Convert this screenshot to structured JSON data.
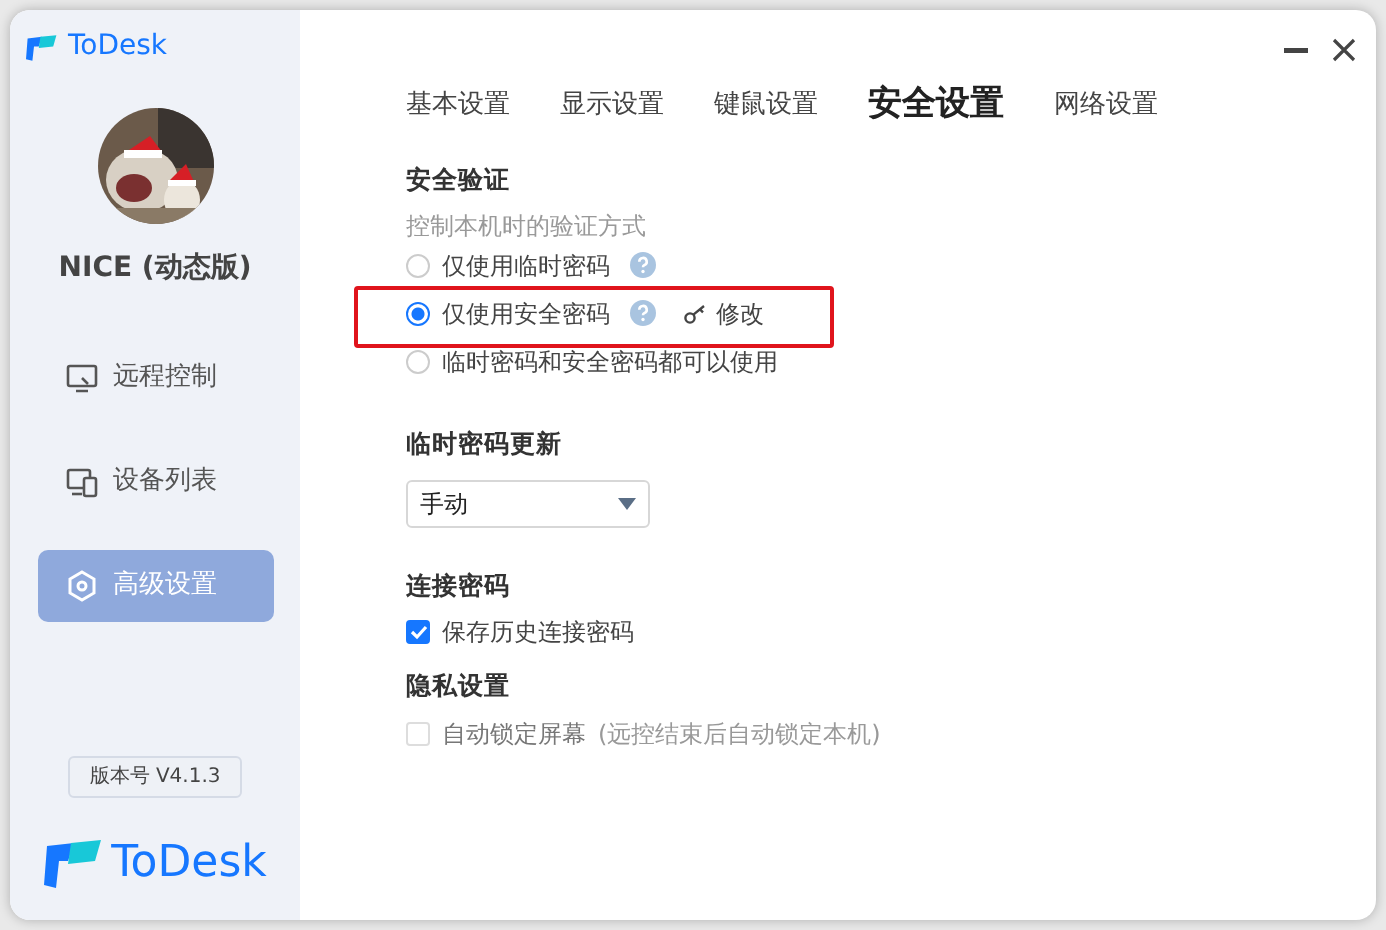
{
  "app": {
    "name": "ToDesk"
  },
  "profile": {
    "name": "NICE (动态版)"
  },
  "nav": [
    {
      "label": "远程控制",
      "selected": false
    },
    {
      "label": "设备列表",
      "selected": false
    },
    {
      "label": "高级设置",
      "selected": true
    }
  ],
  "version": "版本号 V4.1.3",
  "footer_logo": "ToDesk",
  "tabs": [
    {
      "label": "基本设置",
      "selected": false
    },
    {
      "label": "显示设置",
      "selected": false
    },
    {
      "label": "键鼠设置",
      "selected": false
    },
    {
      "label": "安全设置",
      "selected": true
    },
    {
      "label": "网络设置",
      "selected": false
    }
  ],
  "security": {
    "title": "安全验证",
    "subtitle": "控制本机时的验证方式",
    "options": [
      {
        "label": "仅使用临时密码",
        "selected": false,
        "help": true,
        "highlighted": false
      },
      {
        "label": "仅使用安全密码",
        "selected": true,
        "help": true,
        "action": "修改",
        "highlighted": true
      },
      {
        "label": "临时密码和安全密码都可以使用",
        "selected": false,
        "help": false,
        "highlighted": false
      }
    ]
  },
  "temp_password": {
    "title": "临时密码更新",
    "value": "手动"
  },
  "connect_password": {
    "title": "连接密码",
    "checkbox": {
      "label": "保存历史连接密码",
      "checked": true,
      "disabled": false
    }
  },
  "privacy": {
    "title": "隐私设置",
    "checkbox": {
      "label": "自动锁定屏幕",
      "note": "(远控结束后自动锁定本机)",
      "checked": false,
      "disabled": true
    }
  }
}
